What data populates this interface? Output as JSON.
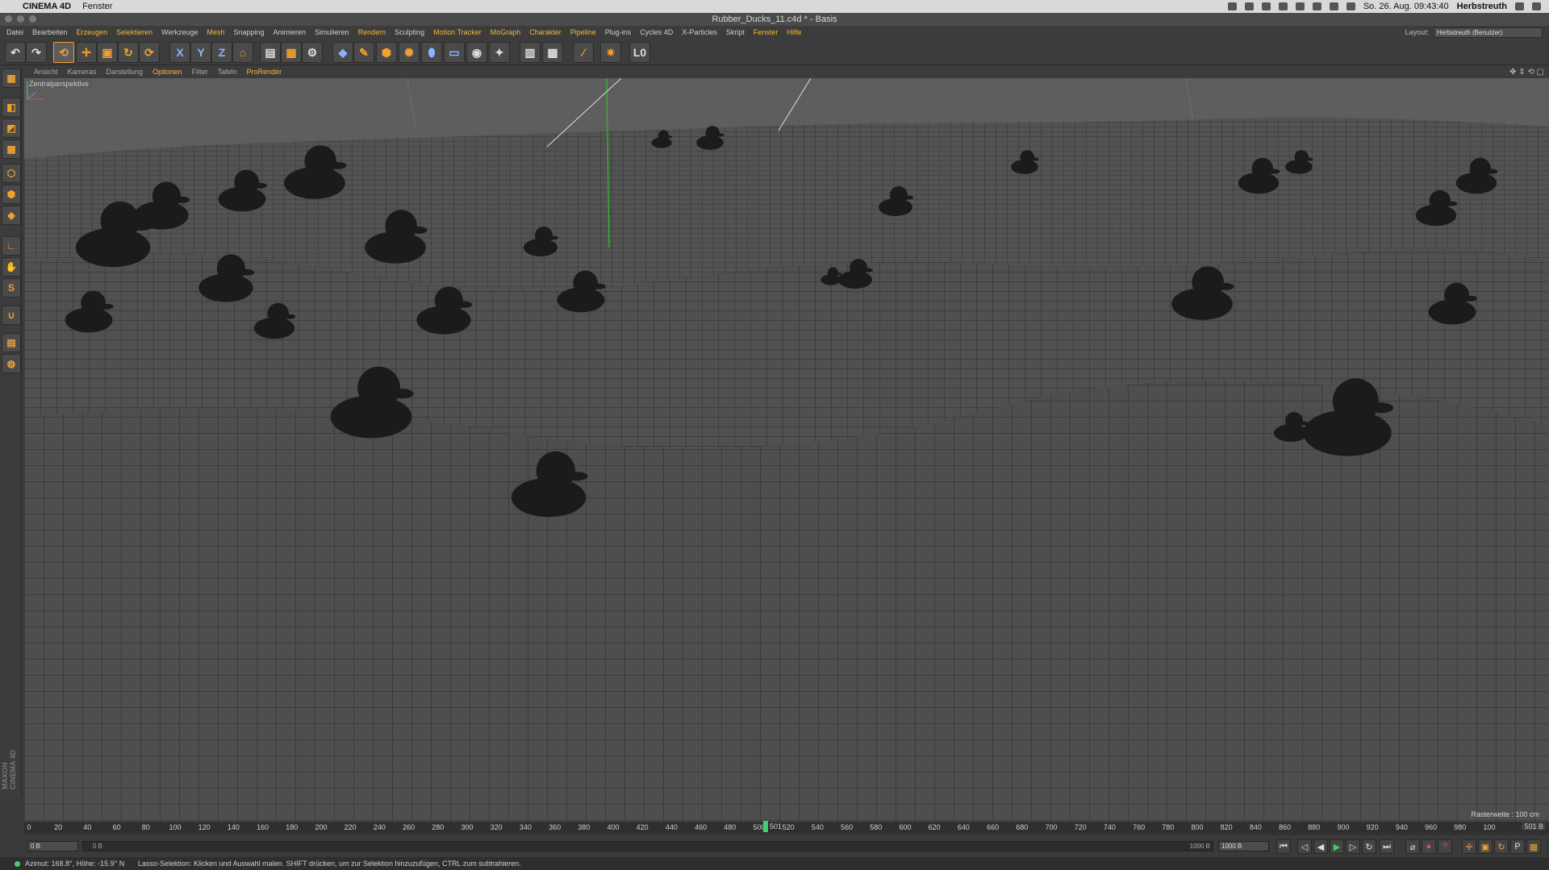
{
  "mac_menubar": {
    "app": "CINEMA 4D",
    "menu": "Fenster",
    "clock": "So. 26. Aug.  09:43:40",
    "user": "Herbstreuth"
  },
  "window": {
    "title": "Rubber_Ducks_11.c4d * - Basis"
  },
  "menus": [
    {
      "label": "Datei",
      "hl": false
    },
    {
      "label": "Bearbeiten",
      "hl": false
    },
    {
      "label": "Erzeugen",
      "hl": true
    },
    {
      "label": "Selektieren",
      "hl": true
    },
    {
      "label": "Werkzeuge",
      "hl": false
    },
    {
      "label": "Mesh",
      "hl": true
    },
    {
      "label": "Snapping",
      "hl": false
    },
    {
      "label": "Animieren",
      "hl": false
    },
    {
      "label": "Simulieren",
      "hl": false
    },
    {
      "label": "Rendern",
      "hl": true
    },
    {
      "label": "Sculpting",
      "hl": false
    },
    {
      "label": "Motion Tracker",
      "hl": true
    },
    {
      "label": "MoGraph",
      "hl": true
    },
    {
      "label": "Charakter",
      "hl": true
    },
    {
      "label": "Pipeline",
      "hl": true
    },
    {
      "label": "Plug-ins",
      "hl": false
    },
    {
      "label": "Cycles 4D",
      "hl": false
    },
    {
      "label": "X-Particles",
      "hl": false
    },
    {
      "label": "Skript",
      "hl": false
    },
    {
      "label": "Fenster",
      "hl": true
    },
    {
      "label": "Hilfe",
      "hl": true
    }
  ],
  "layout": {
    "label": "Layout:",
    "value": "Herbstreuth (Benutzer)"
  },
  "toolbar": {
    "undo_icon": "undo-icon",
    "axis_x": "X",
    "axis_y": "Y",
    "axis_z": "Z",
    "last": "L0"
  },
  "viewport_menu": [
    {
      "label": "Ansicht",
      "hl": false
    },
    {
      "label": "Kameras",
      "hl": false
    },
    {
      "label": "Darstellung",
      "hl": false
    },
    {
      "label": "Optionen",
      "hl": true
    },
    {
      "label": "Filter",
      "hl": false
    },
    {
      "label": "Tafeln",
      "hl": false
    },
    {
      "label": "ProRender",
      "hl": true
    }
  ],
  "viewport": {
    "camera_label": "Zentralperspektive",
    "raster": "Rasterweite : 100 cm"
  },
  "timeline": {
    "ticks": [
      "0",
      "20",
      "40",
      "60",
      "80",
      "100",
      "120",
      "140",
      "160",
      "180",
      "200",
      "220",
      "240",
      "260",
      "280",
      "300",
      "320",
      "340",
      "360",
      "380",
      "400",
      "420",
      "440",
      "460",
      "480",
      "500",
      "520",
      "540",
      "560",
      "580",
      "600",
      "620",
      "640",
      "660",
      "680",
      "700",
      "720",
      "740",
      "760",
      "780",
      "800",
      "820",
      "840",
      "860",
      "880",
      "900",
      "920",
      "940",
      "960",
      "980",
      "100"
    ],
    "current_frame": "501",
    "current_frame_field": "501 B"
  },
  "transport": {
    "start_field": "0 B",
    "slider_start": "0 B",
    "slider_end": "1000 B",
    "end_field": "1000 B"
  },
  "status": {
    "coords": "Azimut: 168.8°, Höhe: -15.9°  N",
    "message": "Lasso-Selektion: Klicken und Auswahl malen. SHIFT drücken, um zur Selektion hinzuzufügen, CTRL zum subtrahieren."
  },
  "brand": {
    "maxon": "MAXON CINEMA 4D"
  }
}
